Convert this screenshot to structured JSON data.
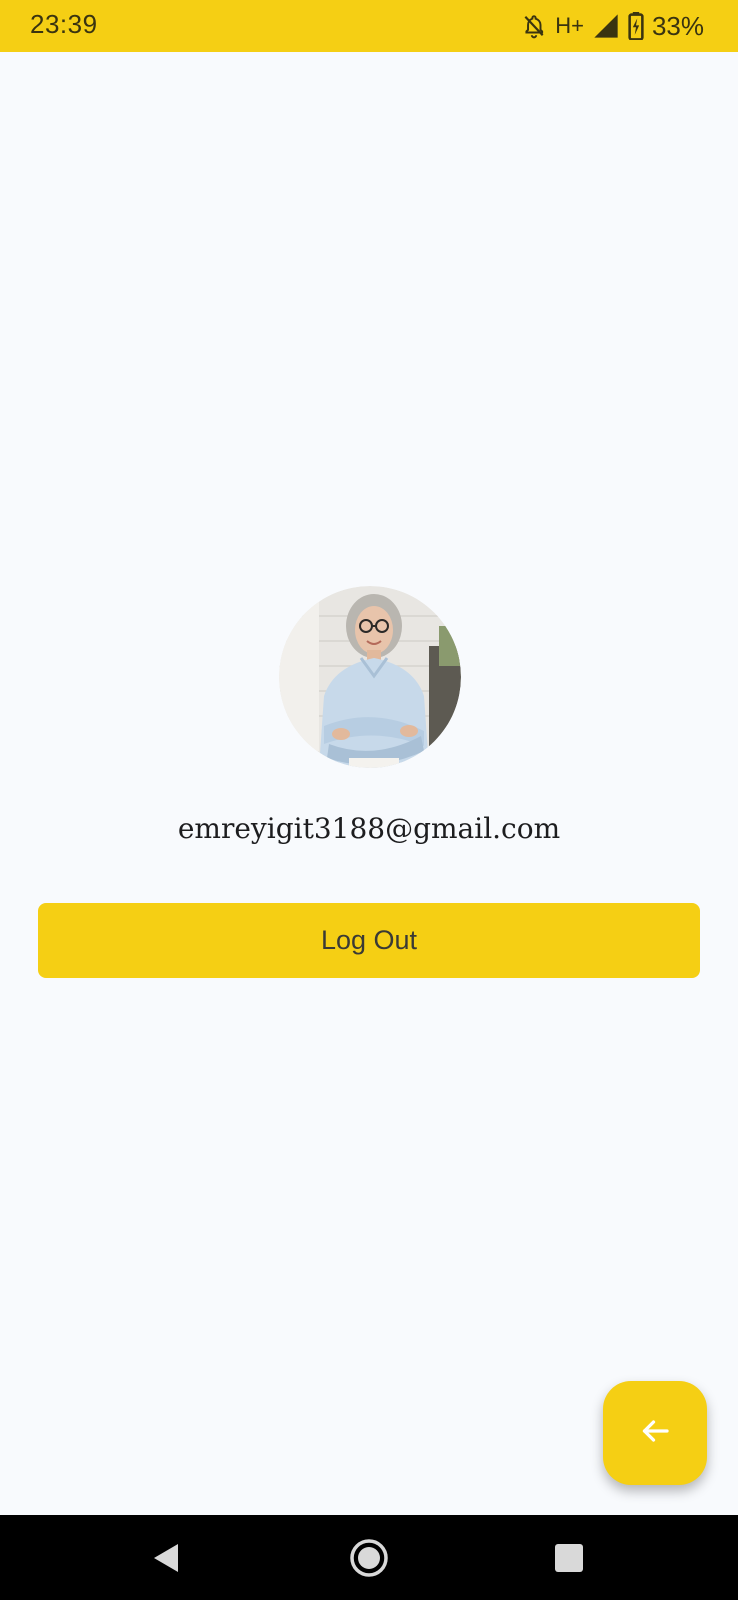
{
  "status_bar": {
    "time": "23:39",
    "network": "H+",
    "battery_percent": "33%",
    "icons": [
      "notifications-off-icon",
      "signal-icon",
      "battery-charging-icon"
    ],
    "background": "#f5cf14"
  },
  "profile": {
    "avatar_icon": "profile-photo",
    "email": "emreyigit3188@gmail.com"
  },
  "actions": {
    "logout_label": "Log Out",
    "accent_color": "#f5cf14"
  },
  "fab": {
    "icon": "arrow-back-icon"
  },
  "nav_bar": {
    "icons": [
      "back-triangle-icon",
      "home-circle-icon",
      "recents-square-icon"
    ]
  }
}
